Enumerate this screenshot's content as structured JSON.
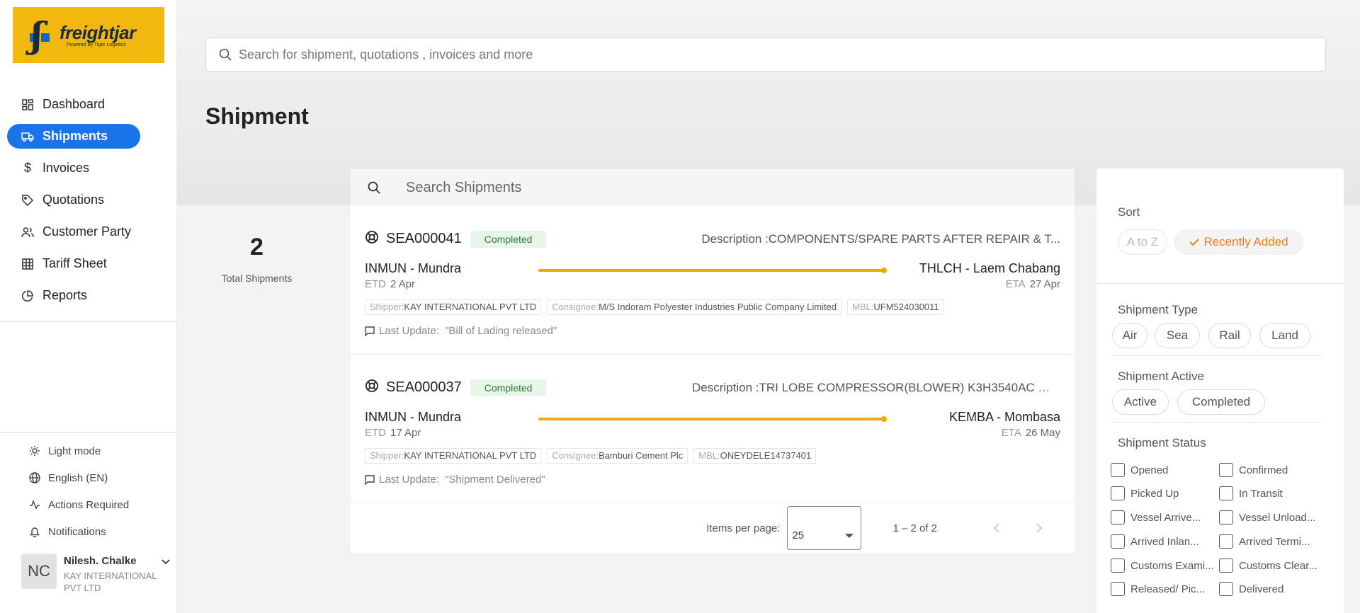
{
  "brand": {
    "name": "freightjar",
    "sub": "Powered by Tiger Logistics"
  },
  "nav": [
    {
      "label": "Dashboard",
      "icon": "dashboard-icon"
    },
    {
      "label": "Shipments",
      "icon": "truck-icon",
      "active": true
    },
    {
      "label": "Invoices",
      "icon": "dollar-icon"
    },
    {
      "label": "Quotations",
      "icon": "tag-icon"
    },
    {
      "label": "Customer Party",
      "icon": "users-icon"
    },
    {
      "label": "Tariff Sheet",
      "icon": "table-icon"
    },
    {
      "label": "Reports",
      "icon": "pie-chart-icon"
    }
  ],
  "bottom_nav": {
    "light_mode": "Light mode",
    "language": "English (EN)",
    "actions": "Actions Required",
    "notifications": "Notifications"
  },
  "user": {
    "initials": "NC",
    "name": "Nilesh. Chalke",
    "org": "KAY INTERNATIONAL PVT LTD"
  },
  "search": {
    "placeholder": "Search for shipment, quotations , invoices and more"
  },
  "page_title": "Shipment",
  "summary": {
    "count": "2",
    "label": "Total Shipments"
  },
  "list": {
    "search_placeholder": "Search Shipments",
    "shipments": [
      {
        "id": "SEA000041",
        "status": "Completed",
        "desc_label": "Description :",
        "desc": "COMPONENTS/SPARE PARTS AFTER REPAIR & T...",
        "from": "INMUN - Mundra",
        "to": "THLCH - Laem Chabang",
        "etd_label": "ETD",
        "etd": "2 Apr",
        "eta_label": "ETA",
        "eta": "27 Apr",
        "shipper_label": "Shipper:",
        "shipper": "KAY INTERNATIONAL PVT LTD",
        "consignee_label": "Consignee:",
        "consignee": "M/S Indoram Polyester Industries Public Company Limited",
        "mbl_label": "MBL:",
        "mbl": "UFM524030011",
        "update_label": "Last Update:",
        "update": "\"Bill of Lading released\""
      },
      {
        "id": "SEA000037",
        "status": "Completed",
        "desc_label": "Description :",
        "desc": "TRI LOBE COMPRESSOR(BLOWER) K3H3540AC WI...",
        "from": "INMUN - Mundra",
        "to": "KEMBA - Mombasa",
        "etd_label": "ETD",
        "etd": "17 Apr",
        "eta_label": "ETA",
        "eta": "26 May",
        "shipper_label": "Shipper:",
        "shipper": "KAY INTERNATIONAL PVT LTD",
        "consignee_label": "Consignee:",
        "consignee": "Bamburi Cement Plc",
        "mbl_label": "MBL:",
        "mbl": "ONEYDELE14737401",
        "update_label": "Last Update:",
        "update": "\"Shipment Delivered\""
      }
    ],
    "paginator": {
      "items_label": "Items per page:",
      "items_value": "25",
      "range": "1 – 2 of 2"
    }
  },
  "filters": {
    "sort_label": "Sort",
    "sort_options": [
      "A to Z",
      "Recently Added"
    ],
    "type_label": "Shipment Type",
    "types": [
      "Air",
      "Sea",
      "Rail",
      "Land"
    ],
    "active_label": "Shipment Active",
    "active_options": [
      "Active",
      "Completed"
    ],
    "status_label": "Shipment Status",
    "statuses": [
      "Opened",
      "Confirmed",
      "Picked Up",
      "In Transit",
      "Vessel Arrive...",
      "Vessel Unload...",
      "Arrived Inlan...",
      "Arrived Termi...",
      "Customs Exami...",
      "Customs Clear...",
      "Released/ Pic...",
      "Delivered"
    ]
  },
  "colors": {
    "accent": "#1a73e8",
    "brand_yellow": "#f2b80e",
    "route": "#f4a800",
    "sort_selected": "#e67e22"
  }
}
